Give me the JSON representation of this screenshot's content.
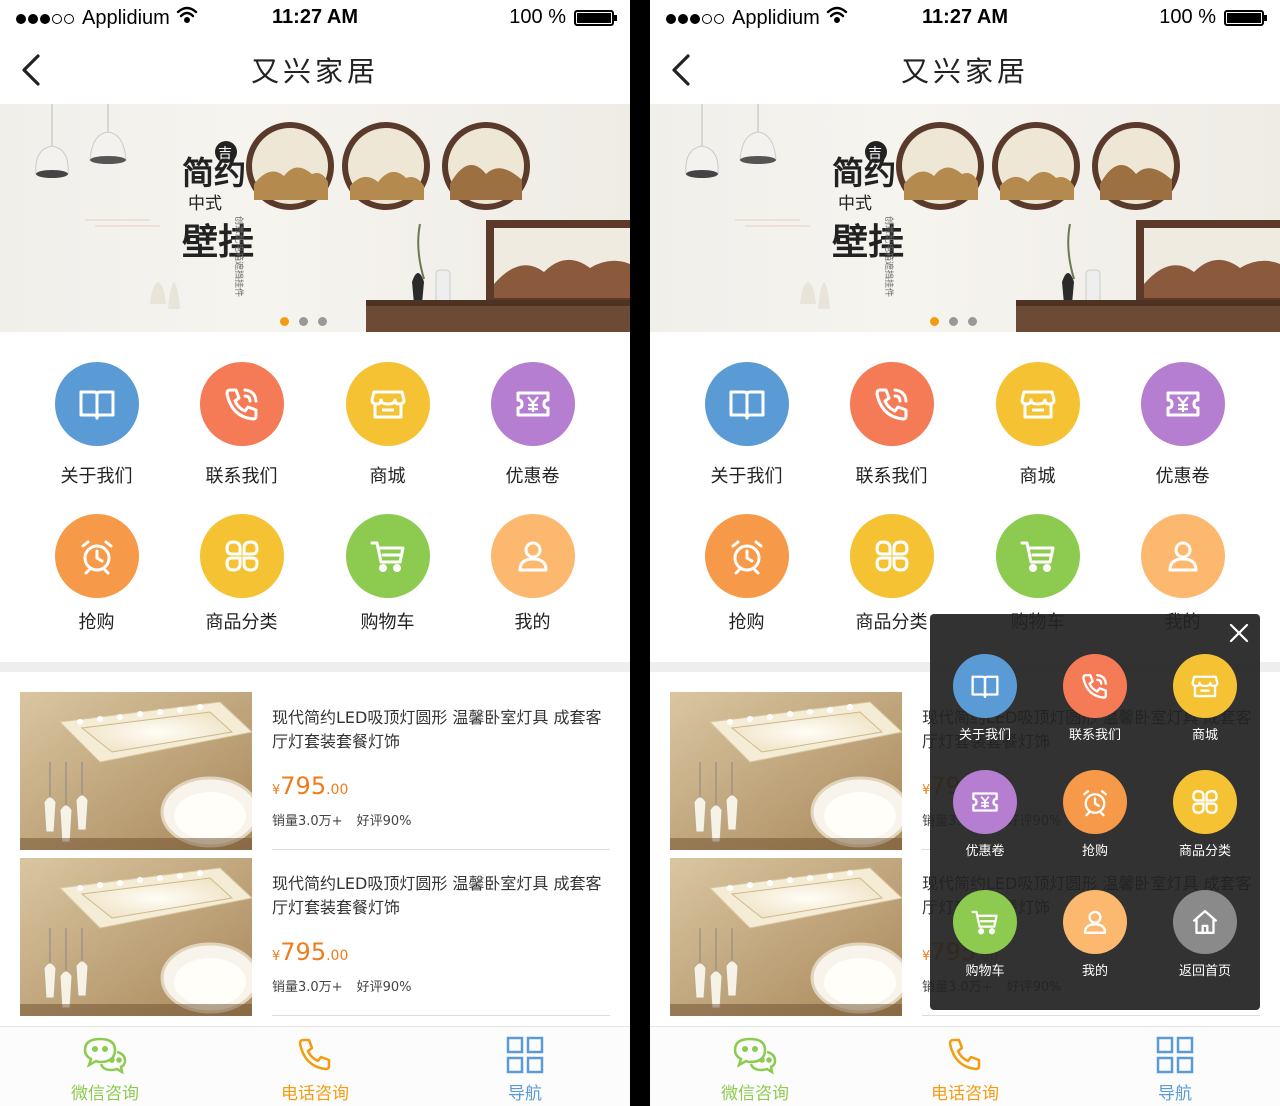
{
  "status_bar": {
    "carrier": "Applidium",
    "time": "11:27 AM",
    "battery": "100 %",
    "signal_bars_filled": 3,
    "signal_bars_total": 5
  },
  "nav": {
    "title": "又兴家居"
  },
  "banner": {
    "lines": [
      "简约",
      "中式",
      "壁挂"
    ],
    "badge": "吉",
    "tagline": "创意配电箱遮挡挂件",
    "pages": 3,
    "active_page": 1
  },
  "icon_grid": [
    {
      "label": "关于我们",
      "icon": "book-icon",
      "color": "#5b9bd5"
    },
    {
      "label": "联系我们",
      "icon": "phone-icon",
      "color": "#f47b56"
    },
    {
      "label": "商城",
      "icon": "store-icon",
      "color": "#f4c233"
    },
    {
      "label": "优惠卷",
      "icon": "coupon-icon",
      "color": "#b57ed0"
    },
    {
      "label": "抢购",
      "icon": "alarm-clock-icon",
      "color": "#f69a4a"
    },
    {
      "label": "商品分类",
      "icon": "category-icon",
      "color": "#f4c233"
    },
    {
      "label": "购物车",
      "icon": "cart-icon",
      "color": "#8ccb4f"
    },
    {
      "label": "我的",
      "icon": "user-icon",
      "color": "#fbb86e"
    }
  ],
  "products": [
    {
      "title": "现代简约LED吸顶灯圆形 温馨卧室灯具 成套客厅灯套装套餐灯饰",
      "currency": "¥",
      "price_int": "795",
      "price_dec": ".00",
      "sales": "销量3.0万+",
      "rating": "好评90%"
    },
    {
      "title": "现代简约LED吸顶灯圆形 温馨卧室灯具 成套客厅灯套装套餐灯饰",
      "currency": "¥",
      "price_int": "795",
      "price_dec": ".00",
      "sales": "销量3.0万+",
      "rating": "好评90%"
    }
  ],
  "tabbar": [
    {
      "label": "微信咨询",
      "icon": "wechat-icon",
      "color": "#8ccb4f"
    },
    {
      "label": "电话咨询",
      "icon": "phone-icon",
      "color": "#f39c12"
    },
    {
      "label": "导航",
      "icon": "grid-icon",
      "color": "#5b9bd5"
    }
  ],
  "overlay_menu": [
    {
      "label": "关于我们",
      "icon": "book-icon",
      "color": "#5b9bd5"
    },
    {
      "label": "联系我们",
      "icon": "phone-icon",
      "color": "#f47b56"
    },
    {
      "label": "商城",
      "icon": "store-icon",
      "color": "#f4c233"
    },
    {
      "label": "优惠卷",
      "icon": "coupon-icon",
      "color": "#b57ed0"
    },
    {
      "label": "抢购",
      "icon": "alarm-clock-icon",
      "color": "#f69a4a"
    },
    {
      "label": "商品分类",
      "icon": "category-icon",
      "color": "#f4c233"
    },
    {
      "label": "购物车",
      "icon": "cart-icon",
      "color": "#8ccb4f"
    },
    {
      "label": "我的",
      "icon": "user-icon",
      "color": "#fbb86e"
    },
    {
      "label": "返回首页",
      "icon": "home-icon",
      "color": "#8a8a8a"
    }
  ]
}
